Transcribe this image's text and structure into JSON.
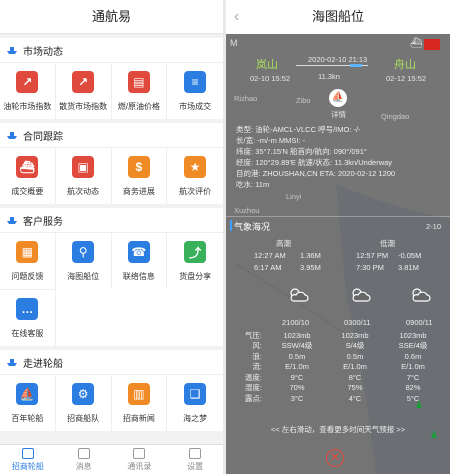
{
  "left": {
    "title": "通航易",
    "sections": [
      {
        "title": "市场动态",
        "items": [
          {
            "label": "油轮市场指数",
            "icon": "trend-up-icon",
            "color": "red"
          },
          {
            "label": "散货市场指数",
            "icon": "trend-up-icon",
            "color": "red"
          },
          {
            "label": "燃/原油价格",
            "icon": "chart-icon",
            "color": "red"
          },
          {
            "label": "市场成交",
            "icon": "document-icon",
            "color": "blue"
          }
        ]
      },
      {
        "title": "合同跟踪",
        "items": [
          {
            "label": "成交概要",
            "icon": "ship-icon",
            "color": "red"
          },
          {
            "label": "航次动态",
            "icon": "briefcase-icon",
            "color": "red"
          },
          {
            "label": "商务进展",
            "icon": "dollar-doc-icon",
            "color": "orange"
          },
          {
            "label": "航次评价",
            "icon": "star-icon",
            "color": "orange"
          }
        ]
      },
      {
        "title": "客户服务",
        "items": [
          {
            "label": "问题反馈",
            "icon": "grid-icon",
            "color": "orange"
          },
          {
            "label": "海图船位",
            "icon": "map-pin-icon",
            "color": "blue"
          },
          {
            "label": "联络信息",
            "icon": "phone-icon",
            "color": "blue"
          },
          {
            "label": "货盘分享",
            "icon": "share-icon",
            "color": "green"
          }
        ],
        "extra": [
          {
            "label": "在线客服",
            "icon": "chat-icon",
            "color": "blue"
          }
        ]
      },
      {
        "title": "走进轮船",
        "items": [
          {
            "label": "百年轮船",
            "icon": "boat-icon",
            "color": "blue"
          },
          {
            "label": "招商船队",
            "icon": "gear-icon",
            "color": "blue"
          },
          {
            "label": "招商新闻",
            "icon": "news-icon",
            "color": "orange"
          },
          {
            "label": "海之梦",
            "icon": "book-icon",
            "color": "blue"
          }
        ]
      }
    ],
    "tabs": [
      {
        "label": "招商轮船",
        "icon": "home-icon",
        "active": true
      },
      {
        "label": "消息",
        "icon": "message-icon",
        "active": false
      },
      {
        "label": "通讯录",
        "icon": "contacts-icon",
        "active": false
      },
      {
        "label": "设置",
        "icon": "settings-icon",
        "active": false
      }
    ]
  },
  "right": {
    "title": "海图船位",
    "route": {
      "from": "岚山",
      "to": "舟山",
      "depart": "02-10 15:52",
      "arrive": "02-12 15:52",
      "now": "2020-02-10 21:13",
      "distance": "11.3kn",
      "detail_label": "详情"
    },
    "ship_info": [
      "类型: 油轮-AMCL-VLCC   呼号/IMO: -/-",
      "长/宽: -m/-m          MMSI: -",
      "纬度: 35°7.15'N        船首向/航向: 090°/091°",
      "经度: 120°29.89'E      航速/状态: 11.3kn/Underway",
      "目的港: ZHOUSHAN,CN    ETA: 2020-02-12 1200",
      "吃水: 11m"
    ],
    "map_labels": [
      "Rizhao",
      "Zibo",
      "Qingdao",
      "Linyi",
      "Xuzhou",
      "Suzhou",
      "Hefei",
      "Anqing",
      "Taizhou",
      "Nanjing"
    ],
    "weather": {
      "title": "气象海况",
      "page": "2-10",
      "high_label": "高潮",
      "low_label": "低潮",
      "high": [
        [
          "12:27 AM",
          "1.36M"
        ],
        [
          "6:17 AM",
          "3.95M"
        ]
      ],
      "low": [
        [
          "12:57 PM",
          "-0.05M"
        ],
        [
          "7:30 PM",
          "3.81M"
        ]
      ],
      "cols": [
        "2100/10",
        "0300/11",
        "0900/11"
      ],
      "rows": [
        {
          "k": "气压:",
          "v": [
            "1023mb",
            "1023mb",
            "1023mb"
          ]
        },
        {
          "k": "风:",
          "v": [
            "SSW/4级",
            "S/4级",
            "SSE/4级"
          ]
        },
        {
          "k": "浪:",
          "v": [
            "0.5m",
            "0.5m",
            "0.6m"
          ]
        },
        {
          "k": "流:",
          "v": [
            "E/1.0m",
            "E/1.0m",
            "E/1.0m"
          ]
        },
        {
          "k": "温度:",
          "v": [
            "9°C",
            "8°C",
            "7°C"
          ]
        },
        {
          "k": "湿度:",
          "v": [
            "70%",
            "75%",
            "82%"
          ]
        },
        {
          "k": "露点:",
          "v": [
            "3°C",
            "4°C",
            "5°C"
          ]
        }
      ],
      "hint": "<< 左右滑动，查看更多时间天气预报 >>"
    }
  }
}
